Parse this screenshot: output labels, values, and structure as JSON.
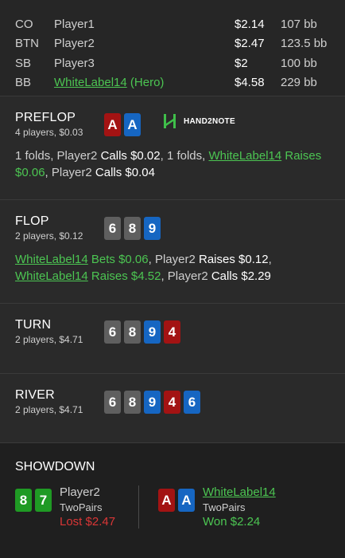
{
  "players": [
    {
      "pos": "CO",
      "name": "Player1",
      "hero_suffix": "",
      "stack": "$2.14",
      "bb": "107 bb"
    },
    {
      "pos": "BTN",
      "name": "Player2",
      "hero_suffix": "",
      "stack": "$2.47",
      "bb": "123.5 bb"
    },
    {
      "pos": "SB",
      "name": "Player3",
      "hero_suffix": "",
      "stack": "$2",
      "bb": "100 bb"
    },
    {
      "pos": "BB",
      "name": "WhiteLabel14",
      "hero_suffix": " (Hero)",
      "stack": "$4.58",
      "bb": "229 bb"
    }
  ],
  "logo": {
    "text": "HAND2NOTE",
    "icon": "hand2note-logo-icon"
  },
  "preflop": {
    "title": "PREFLOP",
    "sub": "4 players, $0.03",
    "cards": [
      {
        "r": "A",
        "c": "red"
      },
      {
        "r": "A",
        "c": "blue"
      }
    ],
    "a1": "1 folds, Player2 ",
    "a2": "Calls $0.02",
    "a3": ", 1 folds, ",
    "a4": "WhiteLabel14",
    "a5": " Raises $0.06",
    "a6": ", Player2 ",
    "a7": "Calls $0.04"
  },
  "flop": {
    "title": "FLOP",
    "sub": "2 players, $0.12",
    "cards": [
      {
        "r": "6",
        "c": "gray"
      },
      {
        "r": "8",
        "c": "gray"
      },
      {
        "r": "9",
        "c": "blue"
      }
    ],
    "a1": "WhiteLabel14",
    "a2": " Bets $0.06",
    "a3": ", Player2 ",
    "a4": "Raises $0.12",
    "a5": ",",
    "a6": "WhiteLabel14",
    "a7": " Raises $4.52",
    "a8": ", Player2 ",
    "a9": "Calls $2.29"
  },
  "turn": {
    "title": "TURN",
    "sub": "2 players, $4.71",
    "cards": [
      {
        "r": "6",
        "c": "gray"
      },
      {
        "r": "8",
        "c": "gray"
      },
      {
        "r": "9",
        "c": "blue"
      },
      {
        "r": "4",
        "c": "red"
      }
    ]
  },
  "river": {
    "title": "RIVER",
    "sub": "2 players, $4.71",
    "cards": [
      {
        "r": "6",
        "c": "gray"
      },
      {
        "r": "8",
        "c": "gray"
      },
      {
        "r": "9",
        "c": "blue"
      },
      {
        "r": "4",
        "c": "red"
      },
      {
        "r": "6",
        "c": "blue"
      }
    ]
  },
  "showdown": {
    "title": "SHOWDOWN",
    "left": {
      "cards": [
        {
          "r": "8",
          "c": "green"
        },
        {
          "r": "7",
          "c": "green"
        }
      ],
      "name": "Player2",
      "hand": "TwoPairs",
      "result": "Lost $2.47"
    },
    "right": {
      "cards": [
        {
          "r": "A",
          "c": "red"
        },
        {
          "r": "A",
          "c": "blue"
        }
      ],
      "name": "WhiteLabel14",
      "hand": "TwoPairs",
      "result": "Won $2.24"
    }
  },
  "colors": {
    "gray": "#5f5f5f",
    "blue": "#1666c2",
    "red": "#a31313",
    "green": "#1f9a24",
    "hero": "#4cc552",
    "lost": "#d93636"
  }
}
